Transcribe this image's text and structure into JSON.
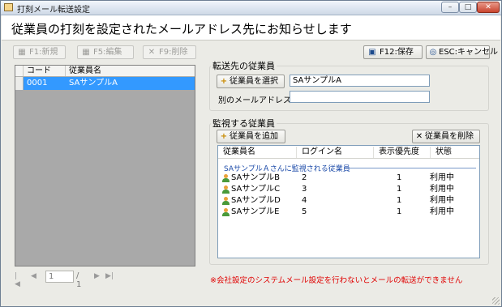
{
  "window": {
    "title": "打刻メール転送設定",
    "min_glyph": "–",
    "max_glyph": "□",
    "close_glyph": "✕"
  },
  "header": {
    "text": "従業員の打刻を設定されたメールアドレス先にお知らせします"
  },
  "toolbar": {
    "new_label": "F1:新規",
    "edit_label": "F5:編集",
    "delete_label": "F9:削除",
    "save_label": "F12:保存",
    "cancel_label": "ESC:キャンセル",
    "new_icon_glyph": "▦",
    "edit_icon_glyph": "▦",
    "delete_icon_glyph": "✕",
    "save_icon_glyph": "▣",
    "cancel_icon_glyph": "◎"
  },
  "employee_grid": {
    "columns": [
      "コード",
      "従業員名"
    ],
    "rows": [
      {
        "code": "0001",
        "name": "SAサンプルA",
        "selected": true
      }
    ]
  },
  "forward_target": {
    "group_label": "転送先の従業員",
    "select_button_label": "従業員を選択",
    "select_button_icon": "+",
    "employee_value": "SAサンプルA",
    "alt_email_label": "別のメールアドレス",
    "alt_email_value": ""
  },
  "monitored": {
    "group_label": "監視する従業員",
    "add_button_label": "従業員を追加",
    "add_button_icon": "+",
    "remove_button_label": "従業員を削除",
    "remove_button_icon": "✕",
    "columns": [
      "従業員名",
      "ログイン名",
      "表示優先度",
      "状態"
    ],
    "group_title": "SAサンプルＡさんに監視される従業員",
    "rows": [
      {
        "name": "SAサンプルB",
        "login": "2",
        "priority": "1",
        "status": "利用中"
      },
      {
        "name": "SAサンプルC",
        "login": "3",
        "priority": "1",
        "status": "利用中"
      },
      {
        "name": "SAサンプルD",
        "login": "4",
        "priority": "1",
        "status": "利用中"
      },
      {
        "name": "SAサンプルE",
        "login": "5",
        "priority": "1",
        "status": "利用中"
      }
    ]
  },
  "pager": {
    "first": "|◀",
    "prev": "◀",
    "next": "▶",
    "last": "▶|",
    "current_page": "1",
    "total": "/ 1"
  },
  "warning": {
    "text": "※会社設定のシステムメール設定を行わないとメールの転送ができません"
  },
  "colors": {
    "selection": "#3399ff",
    "warning": "#e00000",
    "group_title": "#1b4aa8"
  }
}
